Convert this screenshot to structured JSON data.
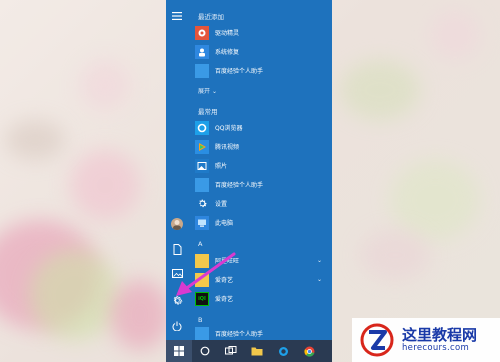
{
  "start_menu": {
    "recently_added_header": "最近添加",
    "recent": [
      {
        "label": "驱动精灵",
        "icon": "driver-genius-icon",
        "color": "#e5553b"
      },
      {
        "label": "系统修复",
        "icon": "system-repair-icon",
        "color": "#2f88e0"
      },
      {
        "label": "百度经验个人助手",
        "icon": "baidu-assistant-icon",
        "color": "#3a9ae6"
      }
    ],
    "expand_label": "展开",
    "most_used_header": "最常用",
    "most_used": [
      {
        "label": "QQ浏览器",
        "icon": "qq-browser-icon",
        "color": "#1ea0e9"
      },
      {
        "label": "腾讯视频",
        "icon": "tencent-video-icon",
        "color": "#2a8ee2"
      },
      {
        "label": "照片",
        "icon": "photos-icon",
        "color": "#1f7ac8"
      },
      {
        "label": "百度经验个人助手",
        "icon": "baidu-assistant-icon",
        "color": "#3a9ae6"
      },
      {
        "label": "设置",
        "icon": "settings-icon",
        "color": "#1e72bd"
      },
      {
        "label": "此电脑",
        "icon": "this-pc-icon",
        "color": "#2e86de"
      }
    ],
    "letter_a": "A",
    "a_apps": [
      {
        "label": "阿里旺旺",
        "icon": "folder-icon",
        "color": "#f2c84b",
        "has_chevron": true
      },
      {
        "label": "爱奇艺",
        "icon": "folder-icon",
        "color": "#f2c84b",
        "has_chevron": true
      },
      {
        "label": "爱奇艺",
        "icon": "iqiyi-icon",
        "color": "#00be06",
        "has_chevron": false
      }
    ],
    "letter_b": "B",
    "b_apps": [
      {
        "label": "百度经验个人助手",
        "icon": "baidu-assistant-icon",
        "color": "#3a9ae6"
      }
    ]
  },
  "rail": [
    "hamburger-icon",
    "user-avatar",
    "documents-icon",
    "pictures-icon",
    "settings-gear-icon",
    "power-icon"
  ],
  "taskbar": [
    "windows-start-icon",
    "search-circle-icon",
    "task-view-icon",
    "file-explorer-icon",
    "qq-browser-icon",
    "chrome-icon"
  ],
  "watermark": {
    "title": "这里教程网",
    "domain": "herecours.com"
  },
  "colors": {
    "menu_bg": "#1e72bd",
    "taskbar_bg": "#2a3a52",
    "arrow": "#d93ad0"
  }
}
